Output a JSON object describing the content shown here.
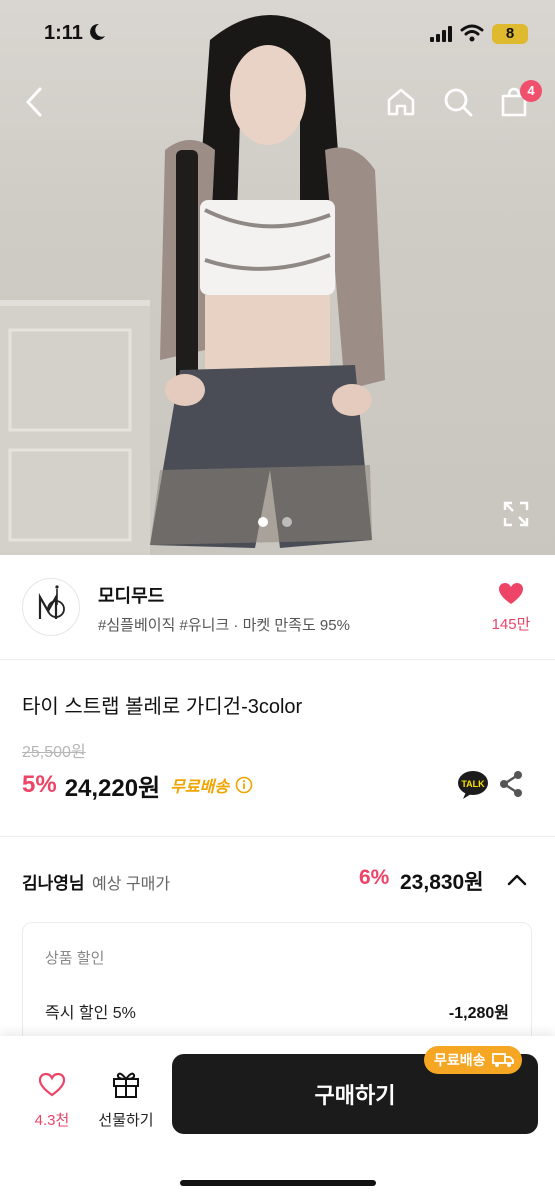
{
  "status_bar": {
    "time": "1:11",
    "battery": "8"
  },
  "nav": {
    "cart_count": "4"
  },
  "hero": {
    "page_count": 2,
    "current_page": 1
  },
  "brand": {
    "name": "모디무드",
    "tags": "#심플베이직 #유니크 · 마켓 만족도 95%",
    "like_count": "145만"
  },
  "product": {
    "title": "타이 스트랩 볼레로 가디건-3color",
    "original_price": "25,500원",
    "discount_rate": "5%",
    "price": "24,220원",
    "shipping_label": "무료배송"
  },
  "member_price": {
    "name": "김나영님",
    "label": "예상 구매가",
    "discount_rate": "6%",
    "price": "23,830원"
  },
  "discount_box": {
    "heading": "상품 할인",
    "rows": [
      {
        "label": "즉시 할인 5%",
        "value": "-1,280원"
      }
    ]
  },
  "bottom_bar": {
    "wish_count": "4.3천",
    "gift_label": "선물하기",
    "buy_label": "구매하기",
    "shipping_badge": "무료배송"
  },
  "colors": {
    "accent_pink": "#ee4468",
    "shipping_orange": "#f0a500",
    "button_dark": "#1b1b1b"
  }
}
